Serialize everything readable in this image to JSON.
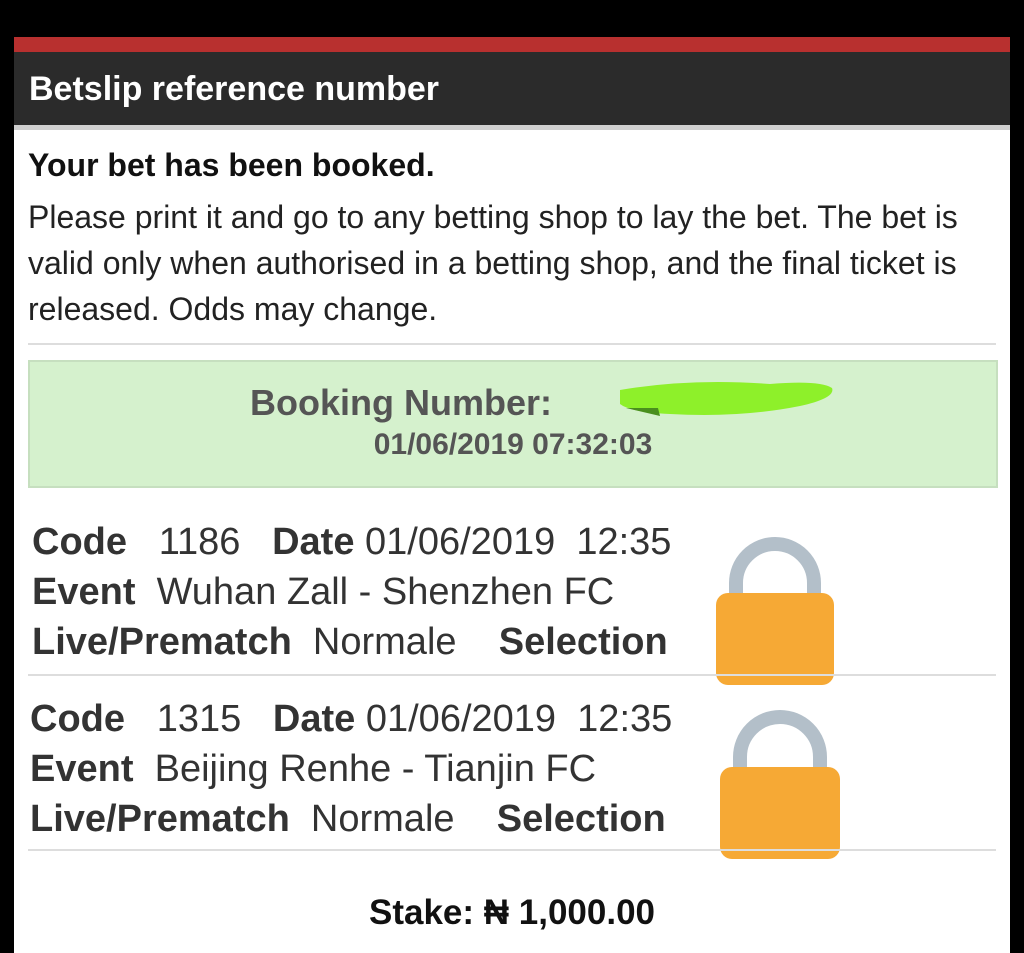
{
  "header": {
    "title": "Betslip reference number"
  },
  "message": {
    "title": "Your bet has been booked.",
    "body": "Please print it and go to any betting shop to lay the bet. The bet is valid only when authorised in a betting shop, and the final ticket is released. Odds may change."
  },
  "booking": {
    "label": "Booking Number:",
    "datetime": "01/06/2019 07:32:03"
  },
  "labels": {
    "code": "Code",
    "date": "Date",
    "event": "Event",
    "live_prematch": "Live/Prematch",
    "selection": "Selection"
  },
  "bets": [
    {
      "code": "1186",
      "date": "01/06/2019",
      "time": "12:35",
      "event": "Wuhan Zall - Shenzhen FC",
      "type": "Normale"
    },
    {
      "code": "1315",
      "date": "01/06/2019",
      "time": "12:35",
      "event": "Beijing Renhe - Tianjin FC",
      "type": "Normale"
    }
  ],
  "stake": {
    "text": "Stake: ₦ 1,000.00"
  },
  "colors": {
    "header_bg": "#2b2b2b",
    "accent_red": "#b8302f",
    "booking_bg": "#d5f1cd",
    "lock": "#f6a935",
    "scribble": "#8ef02a"
  },
  "icons": {
    "lock": "lock-icon"
  }
}
